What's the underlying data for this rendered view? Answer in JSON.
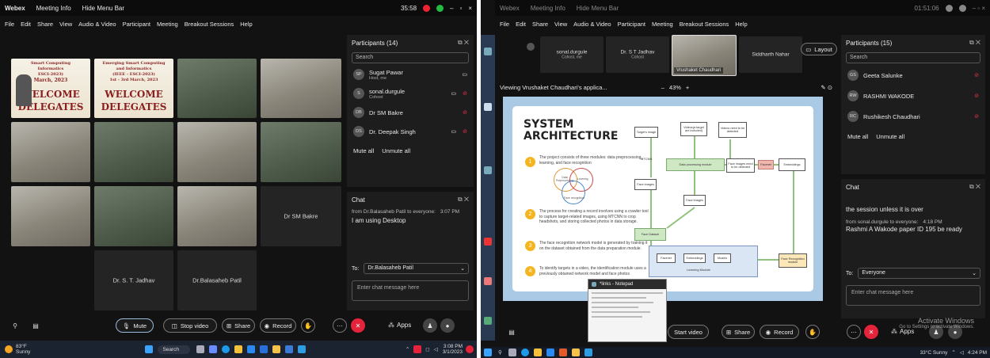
{
  "left": {
    "titlebar": {
      "app": "Webex",
      "meeting_info": "Meeting Info",
      "hide_menu": "Hide Menu Bar",
      "timer": "35:58",
      "minimize": "–",
      "restore": "▫",
      "close": "×"
    },
    "menu": [
      "File",
      "Edit",
      "Share",
      "View",
      "Audio & Video",
      "Participant",
      "Meeting",
      "Breakout Sessions",
      "Help"
    ],
    "banner": {
      "line1": "Smart Computing",
      "line2": "Informatics",
      "line3": "ESCI-2023)",
      "line4": "March, 2023",
      "line5": "WELCOME",
      "line6": "DELEGATES"
    },
    "banner2": {
      "line1": "Emerging Smart Computing",
      "line2": "and Informatics",
      "line3": "(IEEE - ESCI-2023)",
      "line4": "1st - 3rd March, 2023",
      "line5": "WELCOME",
      "line6": "DELEGATES"
    },
    "tiles": {
      "dr_sm_bakre": "Dr SM Bakre",
      "dr_st_jadhav": "Dr. S. T. Jadhav",
      "dr_balasaheb": "Dr.Balasaheb Patil"
    },
    "participants": {
      "title": "Participants (14)",
      "search_placeholder": "Search",
      "items": [
        {
          "initials": "SP",
          "name": "Sugat Pawar",
          "role": "Host, me"
        },
        {
          "initials": "S",
          "name": "sonal.durgule",
          "role": "Cohost"
        },
        {
          "initials": "DB",
          "name": "Dr SM Bakre",
          "role": ""
        },
        {
          "initials": "DS",
          "name": "Dr. Deepak Singh",
          "role": ""
        }
      ],
      "mute_all": "Mute all",
      "unmute_all": "Unmute all"
    },
    "chat": {
      "title": "Chat",
      "msg_from": "from Dr.Balasaheb Patil to everyone:",
      "msg_time": "3:07 PM",
      "msg_text": "I am using Desktop",
      "to_label": "To:",
      "to_value": "Dr.Balasaheb Patil",
      "placeholder": "Enter chat message here"
    },
    "controls": {
      "mute": "Mute",
      "stop_video": "Stop video",
      "share": "Share",
      "record": "Record",
      "apps": "Apps"
    },
    "taskbar": {
      "weather_temp": "83°F",
      "weather_cond": "Sunny",
      "search": "Search",
      "time": "3:08 PM",
      "date": "3/1/2023"
    }
  },
  "right": {
    "titlebar": {
      "app": "Webex",
      "meeting_info": "Meeting Info",
      "hide_menu": "Hide Menu Bar",
      "timer": "01:51:06"
    },
    "menu": [
      "File",
      "Edit",
      "Share",
      "View",
      "Audio & Video",
      "Participant",
      "Meeting",
      "Breakout Sessions",
      "Help"
    ],
    "strip": [
      {
        "name": "sonal.durgule",
        "sub": "Cohost, me"
      },
      {
        "name": "Dr. S T Jadhav",
        "sub": "Cohost"
      },
      {
        "name": "Vrushaket Chaudhari",
        "sub": ""
      },
      {
        "name": "Siddharth Nahar",
        "sub": ""
      }
    ],
    "layout": "Layout",
    "viewing": "Viewing Vrushaket Chaudhari's applica...",
    "zoom": "43%",
    "slide": {
      "title": "SYSTEM ARCHITECTURE",
      "bullets": [
        "The project consists of three modules: data preprocessing, learning, and face recognition",
        "The process for creating a record involves using a crawler tool to capture target-related images, using MTCNN to crop headshots, and storing collected photos in data storage.",
        "The face recognition network model is generated by training it on the dataset obtained from the data preparation module.",
        "To identify targets in a video, the identification module uses a previously obtained network model and face photos"
      ],
      "venn": [
        "Data Preprocessing",
        "Learning",
        "Face recognition"
      ],
      "flow": {
        "target_image": "Target's image",
        "videos_target": "Videos(a target are included)",
        "videos_detected": "Videos need to be detected",
        "mtcnn": "MTCNN",
        "data_processing": "Data processing module",
        "face_images_detected": "Face images need to be detected",
        "facenet": "Facenet",
        "embeddings": "Embeddings",
        "face_images": "Face images",
        "face_images2": "Face images",
        "face_dataset": "Face Dataset",
        "facenet2": "Facenet",
        "embeddings2": "Embeddings",
        "models": "Models",
        "learning_module": "Learning Module",
        "face_recognition_module": "Face Recognition module"
      }
    },
    "notepad": {
      "title": "*links - Notepad"
    },
    "participants": {
      "title": "Participants (15)",
      "search_placeholder": "Search",
      "items": [
        {
          "initials": "GS",
          "name": "Geeta Salunke"
        },
        {
          "initials": "RW",
          "name": "RASHMI WAKODE"
        },
        {
          "initials": "RC",
          "name": "Rushikesh Chaudhari"
        }
      ],
      "mute_all": "Mute all",
      "unmute_all": "Unmute all"
    },
    "chat": {
      "title": "Chat",
      "msg_prev": "the session unless it is over",
      "msg_from": "from sonal.durgule to everyone:",
      "msg_time": "4:18 PM",
      "msg_text": "Rashmi A Wakode paper ID 195 be ready",
      "to_label": "To:",
      "to_value": "Everyone",
      "placeholder": "Enter chat message here"
    },
    "controls": {
      "start_video": "Start video",
      "share": "Share",
      "record": "Record",
      "apps": "Apps"
    },
    "watermark": {
      "line1": "Activate Windows",
      "line2": "Go to Settings to activate Windows."
    },
    "taskbar": {
      "weather": "33°C Sunny",
      "time": "4:24 PM"
    }
  },
  "colors": {
    "end_red": "#e5233b",
    "webex_bg": "#121212",
    "panel_bg": "#1d1d1d",
    "slide_bg": "#a9c9e4"
  }
}
